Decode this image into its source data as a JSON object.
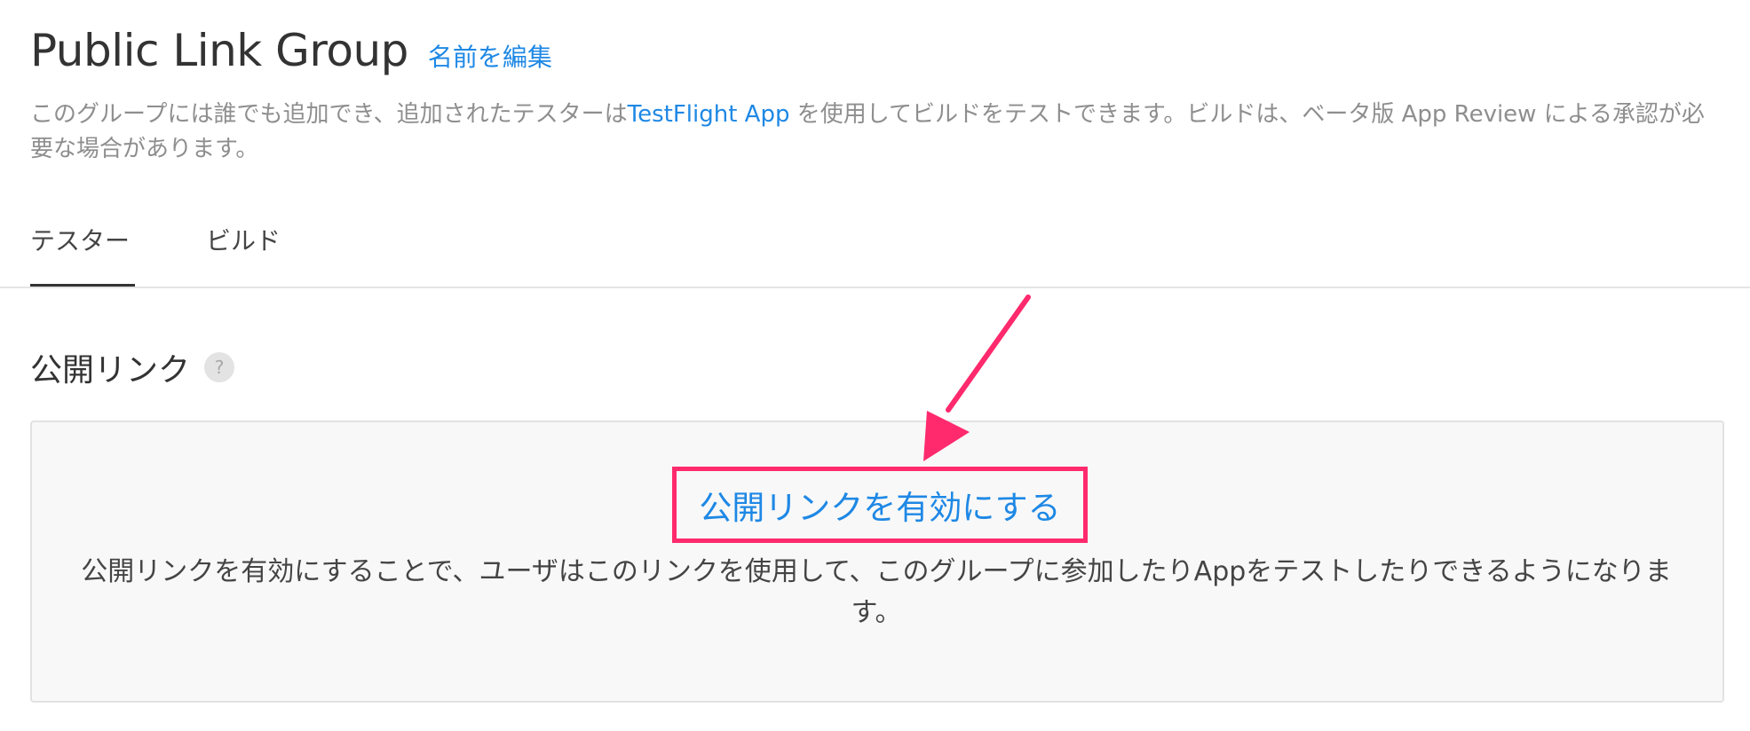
{
  "header": {
    "title": "Public Link Group",
    "edit_label": "名前を編集"
  },
  "description": {
    "part1": "このグループには誰でも追加でき、追加されたテスターは",
    "link": "TestFlight App",
    "part2": " を使用してビルドをテストできます。ビルドは、ベータ版 App Review による承認が必要な場合があります。"
  },
  "tabs": [
    {
      "label": "テスター",
      "selected": true
    },
    {
      "label": "ビルド",
      "selected": false
    }
  ],
  "public_link": {
    "title": "公開リンク",
    "help_glyph": "?",
    "enable_label": "公開リンクを有効にする",
    "description": "公開リンクを有効にすることで、ユーザはこのリンクを使用して、このグループに参加したりAppをテストしたりできるようになります。"
  },
  "colors": {
    "link": "#1e88e5",
    "highlight": "#ff2a6d",
    "panel_bg": "#f8f8f8"
  }
}
